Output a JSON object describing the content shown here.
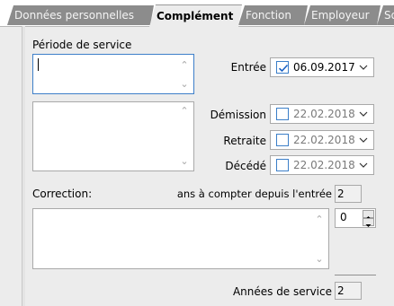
{
  "tabs": [
    {
      "label": "Données personnelles",
      "active": false
    },
    {
      "label": "Complément",
      "active": true
    },
    {
      "label": "Fonction",
      "active": false
    },
    {
      "label": "Employeur",
      "active": false
    },
    {
      "label": "Sold",
      "active": false
    }
  ],
  "service_period": {
    "label": "Période de service",
    "value_top": "",
    "value_bottom": ""
  },
  "dates": {
    "entree": {
      "label": "Entrée",
      "checked": true,
      "value": "06.09.2017"
    },
    "demission": {
      "label": "Démission",
      "checked": false,
      "value": "22.02.2018"
    },
    "retraite": {
      "label": "Retraite",
      "checked": false,
      "value": "22.02.2018"
    },
    "decede": {
      "label": "Décédé",
      "checked": false,
      "value": "22.02.2018"
    }
  },
  "correction": {
    "label": "Correction:",
    "text": "",
    "years_since_entry_label": "ans à compter depuis l'entrée",
    "years_since_entry_value": "2",
    "spinner_value": "0"
  },
  "service_years": {
    "label": "Années de service",
    "value": "2"
  },
  "colors": {
    "tab_inactive": "#8c8c8c",
    "panel": "#ececec",
    "focus_border": "#3e7fc9",
    "check": "#1a62c6"
  }
}
